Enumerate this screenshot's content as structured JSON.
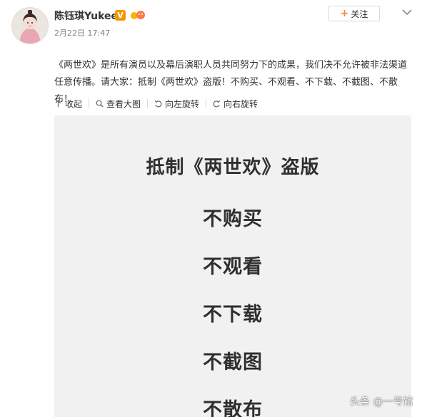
{
  "post": {
    "username": "陈钰琪Yukee",
    "verified_badge": "V",
    "timestamp": "2月22日 17:47",
    "follow_label": "关注",
    "text": "《两世欢》是所有演员以及幕后演职人员共同努力下的成果，我们决不允许被非法渠道任意传播。请大家：抵制《两世欢》盗版！不购买、不观看、不下载、不截图、不散布！"
  },
  "toolbar": {
    "collapse_label": "收起",
    "view_large_label": "查看大图",
    "rotate_left_label": "向左旋转",
    "rotate_right_label": "向右旋转"
  },
  "image": {
    "title": "抵制《两世欢》盗版",
    "lines": [
      "不购买",
      "不观看",
      "不下载",
      "不截图",
      "不散布"
    ]
  },
  "watermark": "头条 @一号馆",
  "icons": {
    "more": "chevron-down-icon",
    "collapse": "arrow-up-icon",
    "view_large": "magnifier-icon",
    "rotate_left": "rotate-left-icon",
    "rotate_right": "rotate-right-icon"
  },
  "colors": {
    "follow_plus": "#ff8140",
    "verified": "#f39800",
    "image_bg": "#f1f1f1"
  }
}
